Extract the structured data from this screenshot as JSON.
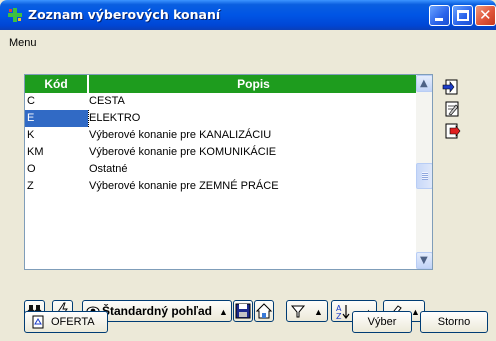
{
  "window": {
    "title": "Zoznam výberových konaní"
  },
  "menu": {
    "label": "Menu"
  },
  "grid": {
    "columns": [
      "Kód",
      "Popis"
    ],
    "rows": [
      {
        "kod": "C",
        "popis": "CESTA"
      },
      {
        "kod": "E",
        "popis": "ELEKTRO"
      },
      {
        "kod": "K",
        "popis": "Výberové konanie pre KANALIZÁCIU"
      },
      {
        "kod": "KM",
        "popis": "Výberové konanie pre KOMUNIKÁCIE"
      },
      {
        "kod": "O",
        "popis": "Ostatné"
      },
      {
        "kod": "Z",
        "popis": "Výberové konanie pre ZEMNÉ PRÁCE"
      }
    ],
    "selected_row": 1
  },
  "toolbar": {
    "view_label": "Štandardný pohľad"
  },
  "buttons": {
    "oferta": "OFERTA",
    "vyber": "Výber",
    "storno": "Storno"
  },
  "colors": {
    "header_green": "#1e9c1e",
    "selection_blue": "#316ac5",
    "titlebar_blue": "#0055e5"
  }
}
